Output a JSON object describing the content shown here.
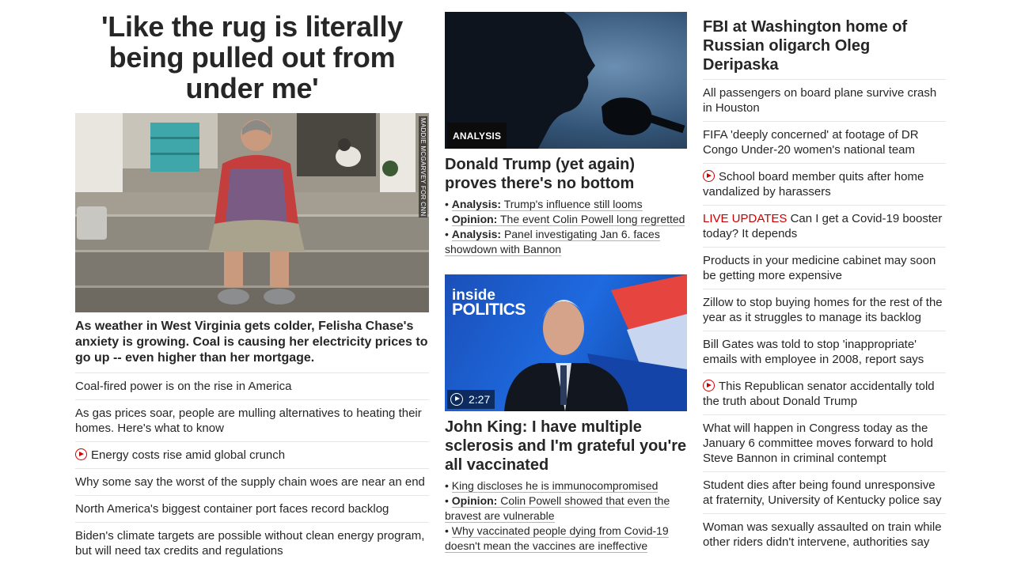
{
  "left": {
    "headline": "'Like the rug is literally being pulled out from under me'",
    "image_credit": "MADDIE MCGARVEY FOR CNN",
    "caption": "As weather in West Virginia gets colder, Felisha Chase's anxiety is growing. Coal is causing her electricity prices to go up -- even higher than her mortgage.",
    "links": [
      {
        "text": "Coal-fired power is on the rise in America",
        "video": false
      },
      {
        "text": "As gas prices soar, people are mulling alternatives to heating their homes. Here's what to know",
        "video": false
      },
      {
        "text": "Energy costs rise amid global crunch",
        "video": true
      },
      {
        "text": "Why some say the worst of the supply chain woes are near an end",
        "video": false
      },
      {
        "text": "North America's biggest container port faces record backlog",
        "video": false
      },
      {
        "text": "Biden's climate targets are possible without clean energy program, but will need tax credits and regulations",
        "video": false
      }
    ]
  },
  "middle": {
    "card1": {
      "badge": "ANALYSIS",
      "title": "Donald Trump (yet again) proves there's no bottom",
      "bullets": [
        {
          "label": "Analysis:",
          "text": "Trump's influence still looms"
        },
        {
          "label": "Opinion:",
          "text": "The event Colin Powell long regretted"
        },
        {
          "label": "Analysis:",
          "text": "Panel investigating Jan 6. faces showdown with Bannon"
        }
      ]
    },
    "card2": {
      "brand_line1": "inside",
      "brand_line2": "POLITICS",
      "duration": "2:27",
      "title": "John King: I have multiple sclerosis and I'm grateful you're all vaccinated",
      "bullets": [
        {
          "label": "",
          "text": "King discloses he is immunocompromised"
        },
        {
          "label": "Opinion:",
          "text": "Colin Powell showed that even the bravest are vulnerable"
        },
        {
          "label": "",
          "text": "Why vaccinated people dying from Covid-19 doesn't mean the vaccines are ineffective"
        }
      ]
    }
  },
  "right": {
    "headline": "FBI at Washington home of Russian oligarch Oleg Deripaska",
    "links": [
      {
        "prefix": "",
        "text": "All passengers on board plane survive crash in Houston",
        "video": false
      },
      {
        "prefix": "",
        "text": "FIFA 'deeply concerned' at footage of DR Congo Under-20 women's national team",
        "video": false
      },
      {
        "prefix": "",
        "text": "School board member quits after home vandalized by harassers",
        "video": true
      },
      {
        "prefix": "LIVE UPDATES",
        "text": "Can I get a Covid-19 booster today? It depends",
        "video": false
      },
      {
        "prefix": "",
        "text": "Products in your medicine cabinet may soon be getting more expensive",
        "video": false
      },
      {
        "prefix": "",
        "text": "Zillow to stop buying homes for the rest of the year as it struggles to manage its backlog",
        "video": false
      },
      {
        "prefix": "",
        "text": "Bill Gates was told to stop 'inappropriate' emails with employee in 2008, report says",
        "video": false
      },
      {
        "prefix": "",
        "text": "This Republican senator accidentally told the truth about Donald Trump",
        "video": true
      },
      {
        "prefix": "",
        "text": "What will happen in Congress today as the January 6 committee moves forward to hold Steve Bannon in criminal contempt",
        "video": false
      },
      {
        "prefix": "",
        "text": "Student dies after being found unresponsive at fraternity, University of Kentucky police say",
        "video": false
      },
      {
        "prefix": "",
        "text": "Woman was sexually assaulted on train while other riders didn't intervene, authorities say",
        "video": false
      }
    ]
  },
  "colors": {
    "text": "#262626",
    "accent_red": "#cc0000",
    "divider": "#e6e6e6",
    "badge_bg": "#0c0c0c"
  }
}
